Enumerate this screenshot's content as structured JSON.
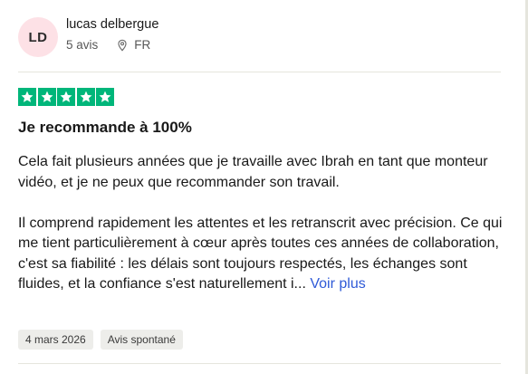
{
  "reviewer": {
    "initials": "LD",
    "name": "lucas delbergue",
    "reviews_count": "5 avis",
    "country": "FR"
  },
  "rating": {
    "stars": 5,
    "max": 5,
    "color": "#00b67a"
  },
  "review": {
    "title": "Je recommande à 100%",
    "paragraph1": "Cela fait plusieurs années que je travaille avec Ibrah en tant que monteur vidéo, et je ne peux que recommander son travail.",
    "paragraph2": "Il comprend rapidement les attentes et les retranscrit avec précision. Ce qui me tient particulièrement à cœur après toutes ces années de collaboration, c'est sa fiabilité : les délais sont toujours respectés, les échanges sont fluides, et la confiance s'est naturellement i...",
    "see_more": "Voir plus"
  },
  "tags": {
    "date": "4 mars 2026",
    "type": "Avis spontané"
  },
  "icons": {
    "location": "location-pin-icon",
    "star": "star-icon"
  }
}
